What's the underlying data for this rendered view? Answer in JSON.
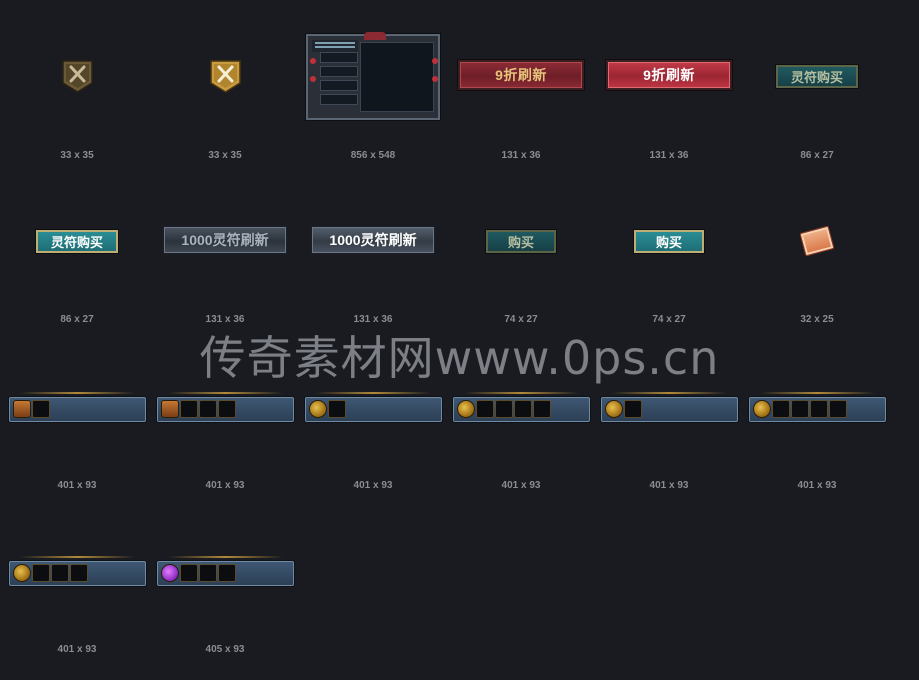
{
  "assets": {
    "close_dark_dims": "33 x 35",
    "close_gold_dims": "33 x 35",
    "panel_dims": "856 x 548",
    "refresh_discount_label": "9折刷新",
    "refresh_discount_dims": "131 x 36",
    "refresh_discount_hover_label": "9折刷新",
    "refresh_discount_hover_dims": "131 x 36",
    "buy_talisman_label": "灵符购买",
    "buy_talisman_dims": "86 x 27",
    "buy_talisman_hover_label": "灵符购买",
    "buy_talisman_hover_dims": "86 x 27",
    "refresh_1000_label": "1000灵符刷新",
    "refresh_1000_dims": "131 x 36",
    "refresh_1000_hover_label": "1000灵符刷新",
    "refresh_1000_hover_dims": "131 x 36",
    "buy_label": "购买",
    "buy_dims": "74 x 27",
    "buy_hover_label": "购买",
    "buy_hover_dims": "74 x 27",
    "scroll_dims": "32 x 25",
    "bar1_dims": "401 x 93",
    "bar2_dims": "401 x 93",
    "bar3_dims": "401 x 93",
    "bar4_dims": "401 x 93",
    "bar5_dims": "401 x 93",
    "bar6_dims": "401 x 93",
    "bar7_dims": "401 x 93",
    "bar8_dims": "405 x 93"
  },
  "watermark": "传奇素材网www.0ps.cn",
  "icons": {
    "close": "x-icon",
    "scroll": "scroll-icon",
    "slot_icon": "orb-icon"
  },
  "colors": {
    "background": "#1a1b20",
    "caption": "#8a8c92",
    "red_button": "#8c2c36",
    "teal_button": "#1f5a60",
    "steel_button": "#4a5460",
    "bar": "#3f5874"
  }
}
